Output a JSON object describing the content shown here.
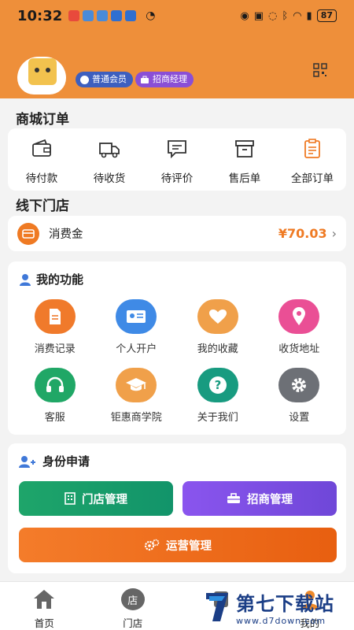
{
  "status_bar": {
    "time": "10:32",
    "battery": "87"
  },
  "profile": {
    "member_badge": "普通会员",
    "manager_badge": "招商经理"
  },
  "orders": {
    "title": "商城订单",
    "items": [
      {
        "label": "待付款",
        "icon": "wallet-icon"
      },
      {
        "label": "待收货",
        "icon": "truck-icon"
      },
      {
        "label": "待评价",
        "icon": "comment-icon"
      },
      {
        "label": "售后单",
        "icon": "box-icon"
      },
      {
        "label": "全部订单",
        "icon": "clipboard-icon"
      }
    ]
  },
  "offline": {
    "title": "线下门店",
    "consume_label": "消费金",
    "consume_amount": "¥70.03"
  },
  "functions": {
    "title": "我的功能",
    "items": [
      {
        "label": "消费记录",
        "icon": "document-icon",
        "color": "#f07a2b"
      },
      {
        "label": "个人开户",
        "icon": "id-card-icon",
        "color": "#3f8ae6"
      },
      {
        "label": "我的收藏",
        "icon": "heart-icon",
        "color": "#f0a04a"
      },
      {
        "label": "收货地址",
        "icon": "location-icon",
        "color": "#ea4f95"
      },
      {
        "label": "客服",
        "icon": "headset-icon",
        "color": "#20a766"
      },
      {
        "label": "钜惠商学院",
        "icon": "graduation-cap-icon",
        "color": "#f0a04a"
      },
      {
        "label": "关于我们",
        "icon": "question-icon",
        "color": "#189b80"
      },
      {
        "label": "设置",
        "icon": "gear-icon",
        "color": "#6d7076"
      }
    ]
  },
  "identity": {
    "title": "身份申请",
    "store_btn": "门店管理",
    "invest_btn": "招商管理",
    "ops_btn": "运营管理"
  },
  "nav": {
    "home": "首页",
    "store": "门店",
    "store_icon_char": "店",
    "mine": "我的"
  },
  "watermark": {
    "text": "第七下载站",
    "url": "www.d7down.com"
  }
}
